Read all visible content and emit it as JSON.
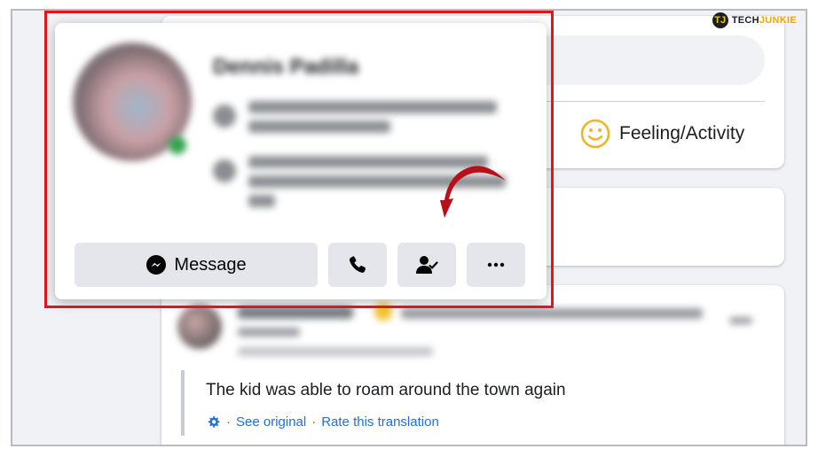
{
  "brand": {
    "mark": "TJ",
    "prefix": "TECH",
    "suffix": "JUNKIE"
  },
  "composer": {
    "feeling_label": "Feeling/Activity"
  },
  "hover_card": {
    "name": "Dennis Padilla",
    "mutual_friends": "Became friends with Abel Dougle and 8 other people",
    "work": "Works at Dawasum Philippines and Pianistan Manufacturing Inc.",
    "actions": {
      "message_label": "Message",
      "call_icon": "phone-icon",
      "friend_icon": "friends-check-icon",
      "more_icon": "more-icon"
    }
  },
  "post": {
    "translated_text": "The kid was able to roam around the town again",
    "links": {
      "separator": "·",
      "see_original": "See original",
      "rate_translation": "Rate this translation"
    }
  },
  "colors": {
    "highlight": "#e0161f",
    "arrow": "#c0121c",
    "link": "#216fdb",
    "button_bg": "#e4e6eb"
  }
}
